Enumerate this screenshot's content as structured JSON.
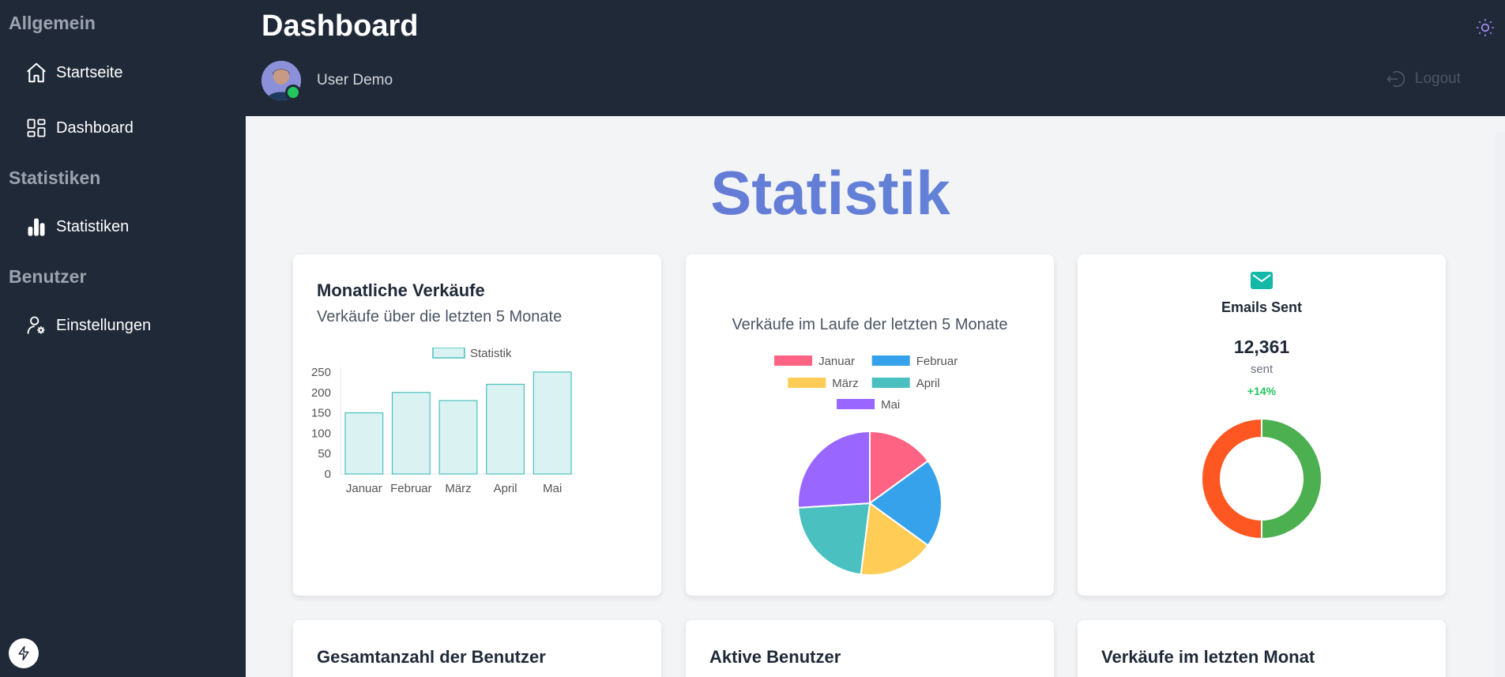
{
  "sidebar": {
    "sections": [
      {
        "title": "Allgemein",
        "items": [
          {
            "label": "Startseite",
            "icon": "home-icon"
          },
          {
            "label": "Dashboard",
            "icon": "dashboard-icon"
          }
        ]
      },
      {
        "title": "Statistiken",
        "items": [
          {
            "label": "Statistiken",
            "icon": "bar-chart-icon"
          }
        ]
      },
      {
        "title": "Benutzer",
        "items": [
          {
            "label": "Einstellungen",
            "icon": "user-settings-icon"
          }
        ]
      }
    ],
    "footer_icon": "bolt-icon"
  },
  "header": {
    "title": "Dashboard",
    "user_name": "User Demo",
    "status": "online",
    "status_color": "#22c55e",
    "logout_label": "Logout",
    "theme_icon": "sun-icon"
  },
  "main": {
    "title": "Statistik",
    "title_colors": [
      "#6b72d8",
      "#5c8bd6"
    ],
    "cards": {
      "sales": {
        "title": "Monatliche Verkäufe",
        "subtitle": "Verkäufe über die letzten 5 Monate"
      },
      "pie": {
        "title": "Verkäufe im Laufe der letzten 5 Monate"
      },
      "emails": {
        "icon": "mail-icon",
        "title": "Emails Sent",
        "value": "12,361",
        "unit": "sent",
        "change": "+14%",
        "change_color": "#22c55e"
      },
      "total_users": {
        "title": "Gesamtanzahl der Benutzer"
      },
      "active_users": {
        "title": "Aktive Benutzer"
      },
      "last_month_sales": {
        "title": "Verkäufe im letzten Monat"
      }
    }
  },
  "chart_data": [
    {
      "type": "bar",
      "categories": [
        "Januar",
        "Februar",
        "März",
        "April",
        "Mai"
      ],
      "series": [
        {
          "name": "Statistik",
          "values": [
            150,
            200,
            180,
            220,
            250
          ],
          "color": "#4bc0c0"
        }
      ],
      "ylim": [
        0,
        250
      ],
      "yticks": [
        "250",
        "200",
        "150",
        "100",
        "50",
        "0"
      ],
      "legend": "top"
    },
    {
      "type": "pie",
      "labels": [
        "Januar",
        "Februar",
        "März",
        "April",
        "Mai"
      ],
      "values": [
        15,
        20,
        17,
        22,
        26
      ],
      "colors": [
        "#ff6384",
        "#36a2eb",
        "#ffcd56",
        "#4bc0c0",
        "#9966ff"
      ],
      "legend": "top"
    },
    {
      "type": "pie",
      "donut": true,
      "values": [
        50,
        50
      ],
      "colors": [
        "#4caf50",
        "#ff5722"
      ]
    }
  ]
}
